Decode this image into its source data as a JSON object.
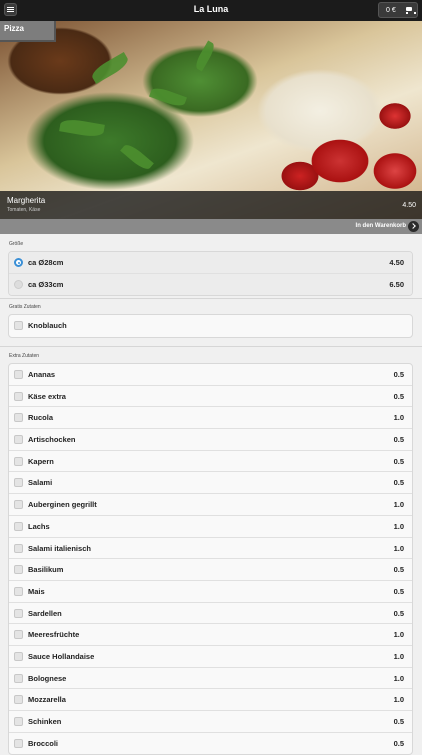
{
  "header": {
    "title": "La Luna",
    "cart_total": "0 €",
    "menu_icon": "menu-icon",
    "cart_icon": "cart-icon"
  },
  "hero": {
    "category": "Pizza",
    "item_name": "Margherita",
    "item_description": "Tomaten, Käse",
    "item_price": "4.50",
    "add_to_cart_label": "In den Warenkorb"
  },
  "size_section": {
    "label": "Größe",
    "options": [
      {
        "label": "ca Ø28cm",
        "price": "4.50",
        "selected": true
      },
      {
        "label": "ca Ø33cm",
        "price": "6.50",
        "selected": false
      }
    ]
  },
  "free_section": {
    "label": "Gratis Zutaten",
    "items": [
      {
        "label": "Knoblauch"
      }
    ]
  },
  "extra_section": {
    "label": "Extra Zutaten",
    "items": [
      {
        "label": "Ananas",
        "price": "0.5"
      },
      {
        "label": "Käse extra",
        "price": "0.5"
      },
      {
        "label": "Rucola",
        "price": "1.0"
      },
      {
        "label": "Artischocken",
        "price": "0.5"
      },
      {
        "label": "Kapern",
        "price": "0.5"
      },
      {
        "label": "Salami",
        "price": "0.5"
      },
      {
        "label": "Auberginen gegrillt",
        "price": "1.0"
      },
      {
        "label": "Lachs",
        "price": "1.0"
      },
      {
        "label": "Salami italienisch",
        "price": "1.0"
      },
      {
        "label": "Basilikum",
        "price": "0.5"
      },
      {
        "label": "Mais",
        "price": "0.5"
      },
      {
        "label": "Sardellen",
        "price": "0.5"
      },
      {
        "label": "Meeresfrüchte",
        "price": "1.0"
      },
      {
        "label": "Sauce Hollandaise",
        "price": "1.0"
      },
      {
        "label": "Bolognese",
        "price": "1.0"
      },
      {
        "label": "Mozzarella",
        "price": "1.0"
      },
      {
        "label": "Schinken",
        "price": "0.5"
      },
      {
        "label": "Broccoli",
        "price": "0.5"
      }
    ]
  }
}
